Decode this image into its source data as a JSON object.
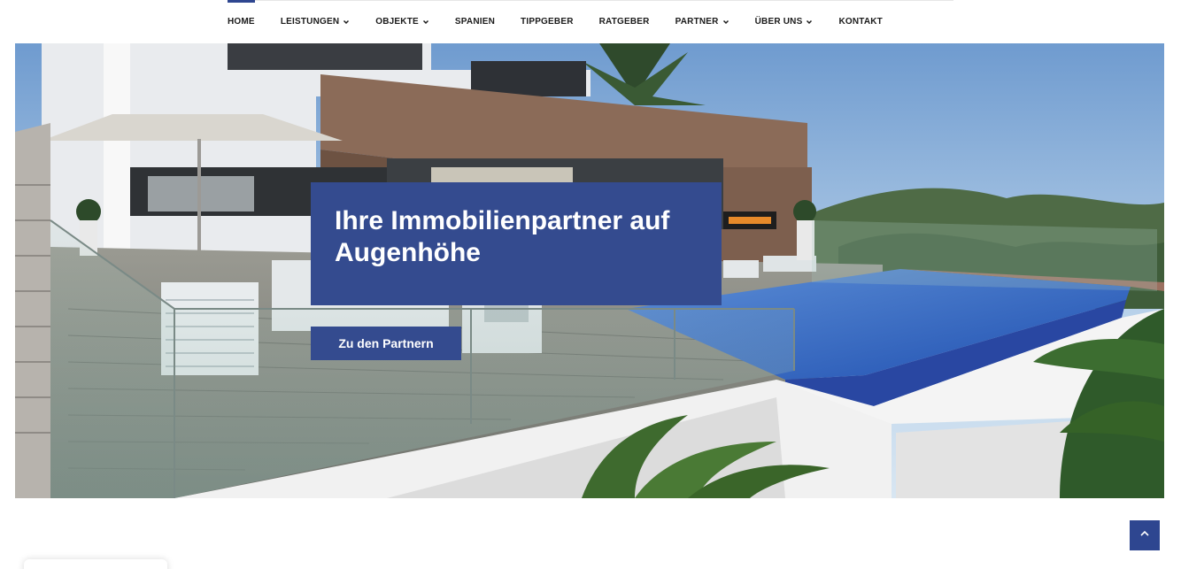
{
  "nav": {
    "items": [
      {
        "label": "HOME",
        "has_dropdown": false,
        "active": true
      },
      {
        "label": "LEISTUNGEN",
        "has_dropdown": true,
        "active": false
      },
      {
        "label": "OBJEKTE",
        "has_dropdown": true,
        "active": false
      },
      {
        "label": "SPANIEN",
        "has_dropdown": false,
        "active": false
      },
      {
        "label": "TIPPGEBER",
        "has_dropdown": false,
        "active": false
      },
      {
        "label": "RATGEBER",
        "has_dropdown": false,
        "active": false
      },
      {
        "label": "PARTNER",
        "has_dropdown": true,
        "active": false
      },
      {
        "label": "ÜBER UNS",
        "has_dropdown": true,
        "active": false
      },
      {
        "label": "KONTAKT",
        "has_dropdown": false,
        "active": false
      }
    ]
  },
  "hero": {
    "headline": "Ihre Immobilienpartner auf Augenhöhe",
    "cta_label": "Zu den Partnern"
  },
  "icons": {
    "dropdown": "chevron-down-icon",
    "scroll_top": "chevron-up-icon"
  },
  "colors": {
    "brand_blue": "#344b8f",
    "nav_active": "#2e4690",
    "nav_text": "#1b1b1b"
  }
}
